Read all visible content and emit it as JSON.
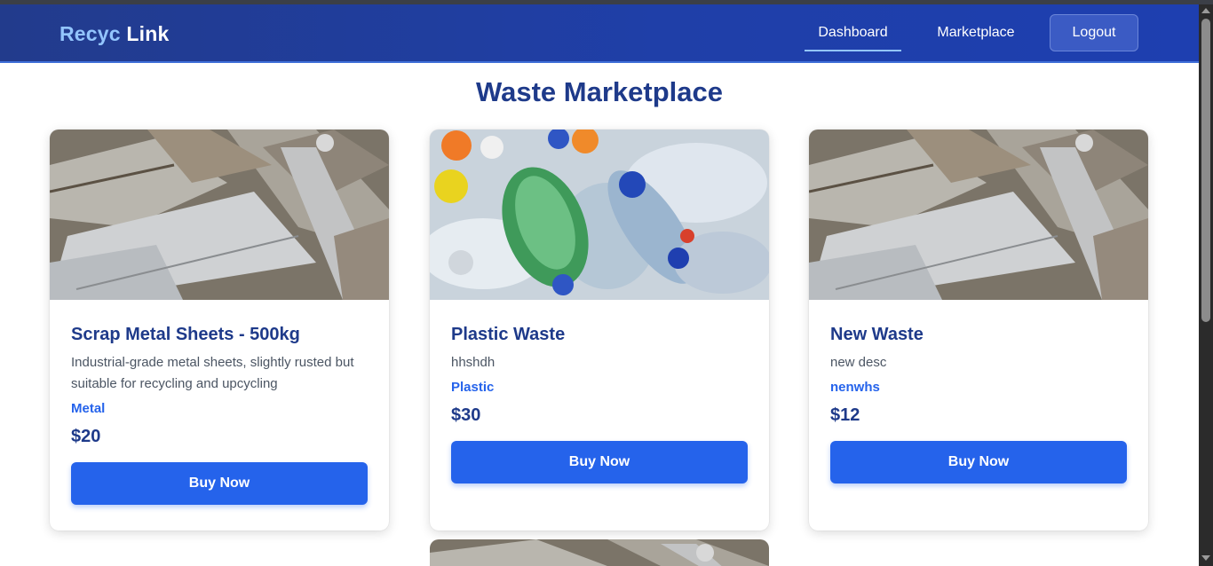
{
  "app": {
    "brand_part1": "Recyc",
    "brand_part2": "Link",
    "accent": "#2563eb",
    "nav_bg": "#1f3fa8"
  },
  "nav": {
    "links": [
      {
        "label": "Dashboard",
        "active": true
      },
      {
        "label": "Marketplace",
        "active": false
      }
    ],
    "logout_label": "Logout"
  },
  "page": {
    "title": "Waste Marketplace"
  },
  "listings": [
    {
      "image": "scrap-metal-photo",
      "title": "Scrap Metal Sheets - 500kg",
      "description": "Industrial-grade metal sheets, slightly rusted but suitable for recycling and upcycling",
      "category": "Metal",
      "price": "$20",
      "buy_label": "Buy Now"
    },
    {
      "image": "plastic-bottles-photo",
      "title": "Plastic Waste",
      "description": "hhshdh",
      "category": "Plastic",
      "price": "$30",
      "buy_label": "Buy Now"
    },
    {
      "image": "scrap-metal-photo",
      "title": "New Waste",
      "description": "new desc",
      "category": "nenwhs",
      "price": "$12",
      "buy_label": "Buy Now"
    }
  ]
}
